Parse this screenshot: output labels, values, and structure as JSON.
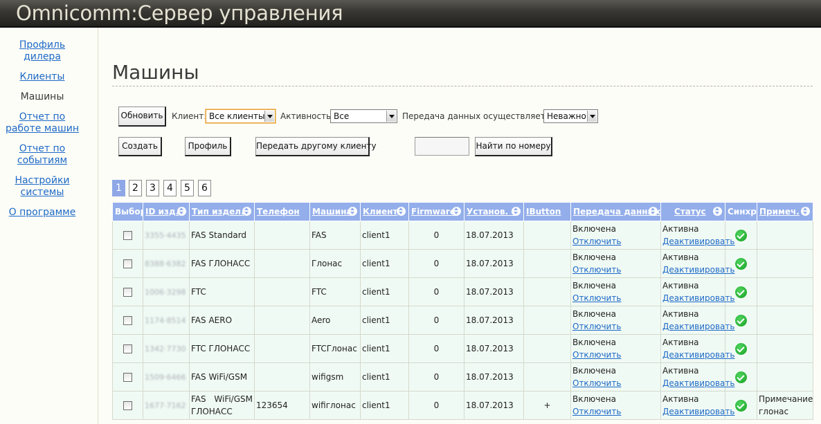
{
  "app": {
    "title": "Omnicomm:Сервер управления"
  },
  "sidebar": {
    "items": [
      {
        "label": "Профиль дилера",
        "link": true
      },
      {
        "label": "Клиенты",
        "link": true
      },
      {
        "label": "Машины",
        "link": false
      },
      {
        "label": "Отчет по работе машин",
        "link": true
      },
      {
        "label": "Отчет по событиям",
        "link": true
      },
      {
        "label": "Настройки системы",
        "link": true
      },
      {
        "label": "О программе",
        "link": true
      }
    ]
  },
  "page": {
    "title": "Машины"
  },
  "toolbar": {
    "refresh_label": "Обновить",
    "client_label": "Клиент:",
    "client_value": "Все клиенты",
    "activity_label": "Активность:",
    "activity_value": "Все",
    "transfer_label": "Передача данных осуществляется:",
    "transfer_value": "Неважно",
    "create_label": "Создать",
    "profile_label": "Профиль",
    "transfer_client_label": "Передать другому клиенту",
    "search_value": "",
    "find_label": "Найти по номеру"
  },
  "pager": {
    "pages": [
      "1",
      "2",
      "3",
      "4",
      "5",
      "6"
    ],
    "current": "1"
  },
  "table": {
    "columns": [
      "Выбор",
      "ID изд.",
      "Тип издел.",
      "Телефон",
      "Машина",
      "Клиент",
      "Firmware",
      "Установ. с",
      "IButton",
      "Передача данных",
      "Статус",
      "Синхр.",
      "Примеч."
    ],
    "rows": [
      {
        "id": "3355·4435",
        "type": "FAS Standard",
        "phone": "",
        "machine": "FAS",
        "client": "client1",
        "firmware": "0",
        "installed": "18.07.2013",
        "ibutton": "",
        "transfer": "Включена",
        "transfer_action": "Отключить",
        "status": "Активна",
        "status_action": "Деактивировать",
        "note": ""
      },
      {
        "id": "8388·6382",
        "type": "FAS ГЛОНАСС",
        "phone": "",
        "machine": "Глонас",
        "client": "client1",
        "firmware": "0",
        "installed": "18.07.2013",
        "ibutton": "",
        "transfer": "Включена",
        "transfer_action": "Отключить",
        "status": "Активна",
        "status_action": "Деактивировать",
        "note": ""
      },
      {
        "id": "1006·3298",
        "type": "FTC",
        "phone": "",
        "machine": "FTC",
        "client": "client1",
        "firmware": "0",
        "installed": "18.07.2013",
        "ibutton": "",
        "transfer": "Включена",
        "transfer_action": "Отключить",
        "status": "Активна",
        "status_action": "Деактивировать",
        "note": ""
      },
      {
        "id": "1174·8514",
        "type": "FAS AERO",
        "phone": "",
        "machine": "Aero",
        "client": "client1",
        "firmware": "0",
        "installed": "18.07.2013",
        "ibutton": "",
        "transfer": "Включена",
        "transfer_action": "Отключить",
        "status": "Активна",
        "status_action": "Деактивировать",
        "note": ""
      },
      {
        "id": "1342·7730",
        "type": "FTC ГЛОНАСС",
        "phone": "",
        "machine": "FTCГлонас",
        "client": "client1",
        "firmware": "0",
        "installed": "18.07.2013",
        "ibutton": "",
        "transfer": "Включена",
        "transfer_action": "Отключить",
        "status": "Активна",
        "status_action": "Деактивировать",
        "note": ""
      },
      {
        "id": "1509·6466",
        "type": "FAS WiFi/GSM",
        "phone": "",
        "machine": "wifigsm",
        "client": "client1",
        "firmware": "0",
        "installed": "18.07.2013",
        "ibutton": "",
        "transfer": "Включена",
        "transfer_action": "Отключить",
        "status": "Активна",
        "status_action": "Деактивировать",
        "note": ""
      },
      {
        "id": "1677·7162",
        "type": "FAS WiFi/GSM ГЛОНАСС",
        "phone": "123654",
        "machine": "wifiглонас",
        "client": "client1",
        "firmware": "0",
        "installed": "18.07.2013",
        "ibutton": "+",
        "transfer": "Включена",
        "transfer_action": "Отключить",
        "status": "Активна",
        "status_action": "Деактивировать",
        "note": "Примечание глонас"
      }
    ]
  }
}
